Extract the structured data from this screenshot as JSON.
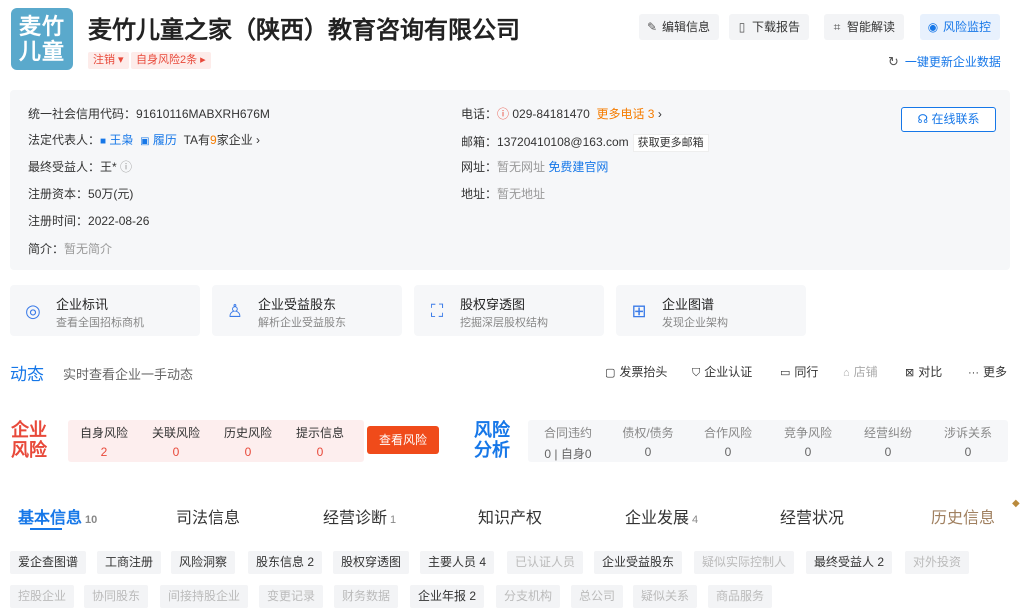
{
  "logo": {
    "line1": "麦竹",
    "line2": "儿童"
  },
  "company": {
    "name": "麦竹儿童之家（陕西）教育咨询有限公司",
    "tags": [
      "注销 ▾",
      "自身风险2条 ▸"
    ]
  },
  "toolbar": {
    "edit": "编辑信息",
    "download": "下载报告",
    "smart": "智能解读",
    "monitor": "风险监控",
    "update": "一键更新企业数据"
  },
  "info": {
    "credit_code_label": "统一社会信用代码：",
    "credit_code": "91610116MABXRH676M",
    "legal_rep_label": "法定代表人：",
    "legal_rep_name": "王枭",
    "resume": "履历",
    "ta_has_prefix": "TA有",
    "ta_count": "9",
    "ta_has_suffix": "家企业 ›",
    "ubo_label": "最终受益人：",
    "ubo_value": "王*",
    "capital_label": "注册资本：",
    "capital_value": "50万(元)",
    "reg_time_label": "注册时间：",
    "reg_time_value": "2022-08-26",
    "intro_label": "简介：",
    "intro_value": "暂无简介",
    "phone_label": "电话：",
    "phone_value": "029-84181470",
    "more_phone": "更多电话 3",
    "email_label": "邮箱：",
    "email_value": "13720410108@163.com",
    "more_email": "获取更多邮箱",
    "website_label": "网址：",
    "website_value": "暂无网址",
    "free_site": "免费建官网",
    "address_label": "地址：",
    "address_value": "暂无地址",
    "online_contact": "在线联系"
  },
  "cards": [
    {
      "title": "企业标讯",
      "sub": "查看全国招标商机"
    },
    {
      "title": "企业受益股东",
      "sub": "解析企业受益股东"
    },
    {
      "title": "股权穿透图",
      "sub": "挖掘深层股权结构"
    },
    {
      "title": "企业图谱",
      "sub": "发现企业架构"
    }
  ],
  "dynamics": {
    "title": "动态",
    "subtitle": "实时查看企业一手动态",
    "actions": [
      "发票抬头",
      "企业认证",
      "同行",
      "店铺",
      "对比",
      "更多"
    ]
  },
  "risk": {
    "label_1": "企业",
    "label_2": "风险",
    "cells": [
      {
        "name": "自身风险",
        "value": "2"
      },
      {
        "name": "关联风险",
        "value": "0"
      },
      {
        "name": "历史风险",
        "value": "0"
      },
      {
        "name": "提示信息",
        "value": "0"
      }
    ],
    "button": "查看风险"
  },
  "analysis": {
    "label_1": "风险",
    "label_2": "分析",
    "cells": [
      {
        "name": "合同违约",
        "value": "0 | 自身0"
      },
      {
        "name": "债权/债务",
        "value": "0"
      },
      {
        "name": "合作风险",
        "value": "0"
      },
      {
        "name": "竞争风险",
        "value": "0"
      },
      {
        "name": "经营纠纷",
        "value": "0"
      },
      {
        "name": "涉诉关系",
        "value": "0"
      }
    ]
  },
  "tabs": [
    {
      "label": "基本信息",
      "count": "10"
    },
    {
      "label": "司法信息",
      "count": ""
    },
    {
      "label": "经营诊断",
      "count": "1"
    },
    {
      "label": "知识产权",
      "count": ""
    },
    {
      "label": "企业发展",
      "count": "4"
    },
    {
      "label": "经营状况",
      "count": ""
    },
    {
      "label": "历史信息",
      "count": ""
    }
  ],
  "chips_row1": [
    "爱企查图谱",
    "工商注册",
    "风险洞察",
    "股东信息 2",
    "股权穿透图",
    "主要人员 4",
    "已认证人员",
    "企业受益股东",
    "疑似实际控制人",
    "最终受益人 2",
    "对外投资"
  ],
  "chips_row2": [
    "控股企业",
    "协同股东",
    "间接持股企业",
    "变更记录",
    "财务数据",
    "企业年报 2",
    "分支机构",
    "总公司",
    "疑似关系",
    "商品服务"
  ]
}
